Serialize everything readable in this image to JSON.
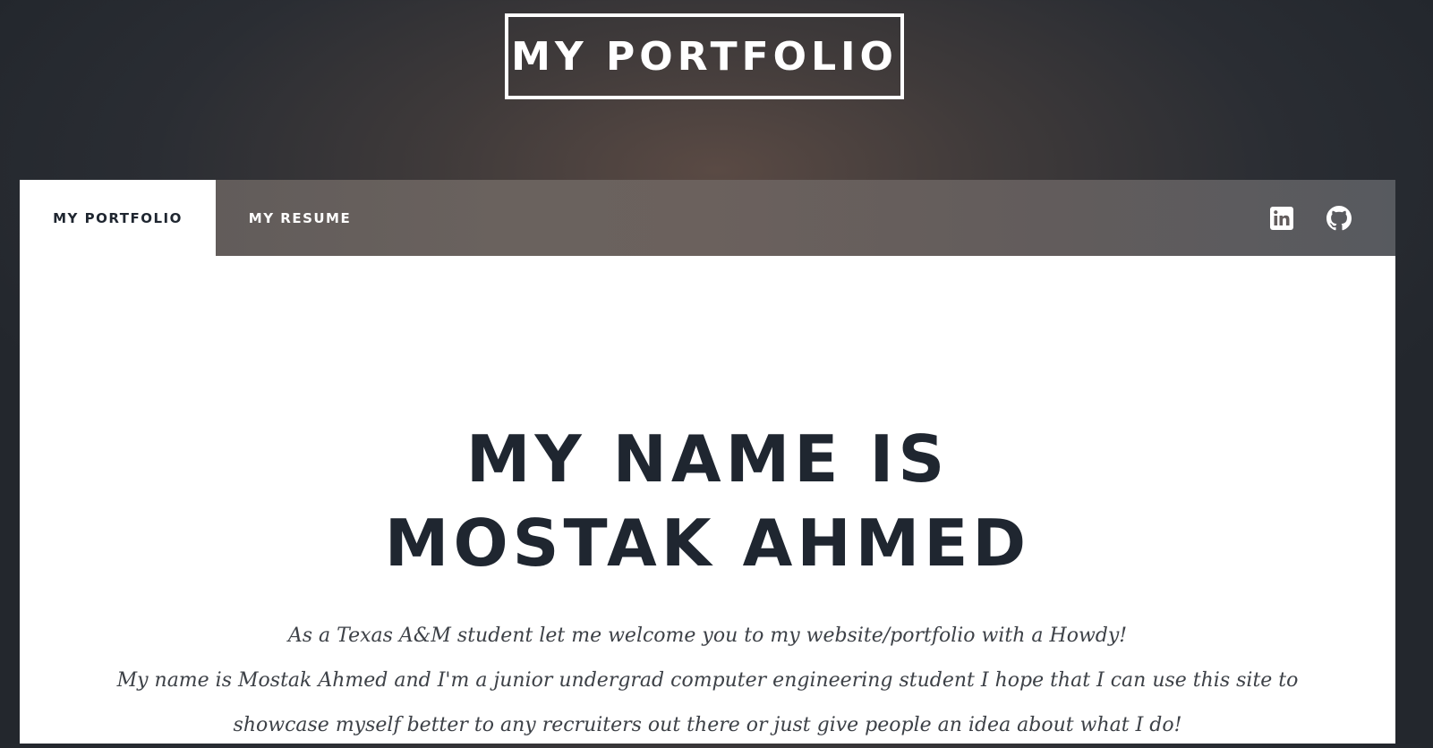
{
  "header": {
    "logo_text": "MY PORTFOLIO"
  },
  "nav": {
    "tabs": [
      {
        "label": "MY PORTFOLIO",
        "active": true
      },
      {
        "label": "MY RESUME",
        "active": false
      }
    ],
    "icons": [
      "linkedin-icon",
      "github-icon"
    ]
  },
  "main": {
    "headline_line1": "MY NAME IS",
    "headline_line2": "MOSTAK AHMED",
    "intro_line1": "As a Texas A&M student let me welcome you to my website/portfolio with a Howdy!",
    "intro_line2": "My name is Mostak Ahmed and I'm a junior undergrad computer engineering student I hope that I can use this site to",
    "intro_line3": "showcase myself better to any recruiters out there or just give people an idea about what I do!"
  },
  "colors": {
    "heading": "#1f2630",
    "body_text": "#3d4147",
    "nav_bg": "#6a625e",
    "page_bg": "#2a2d33"
  }
}
